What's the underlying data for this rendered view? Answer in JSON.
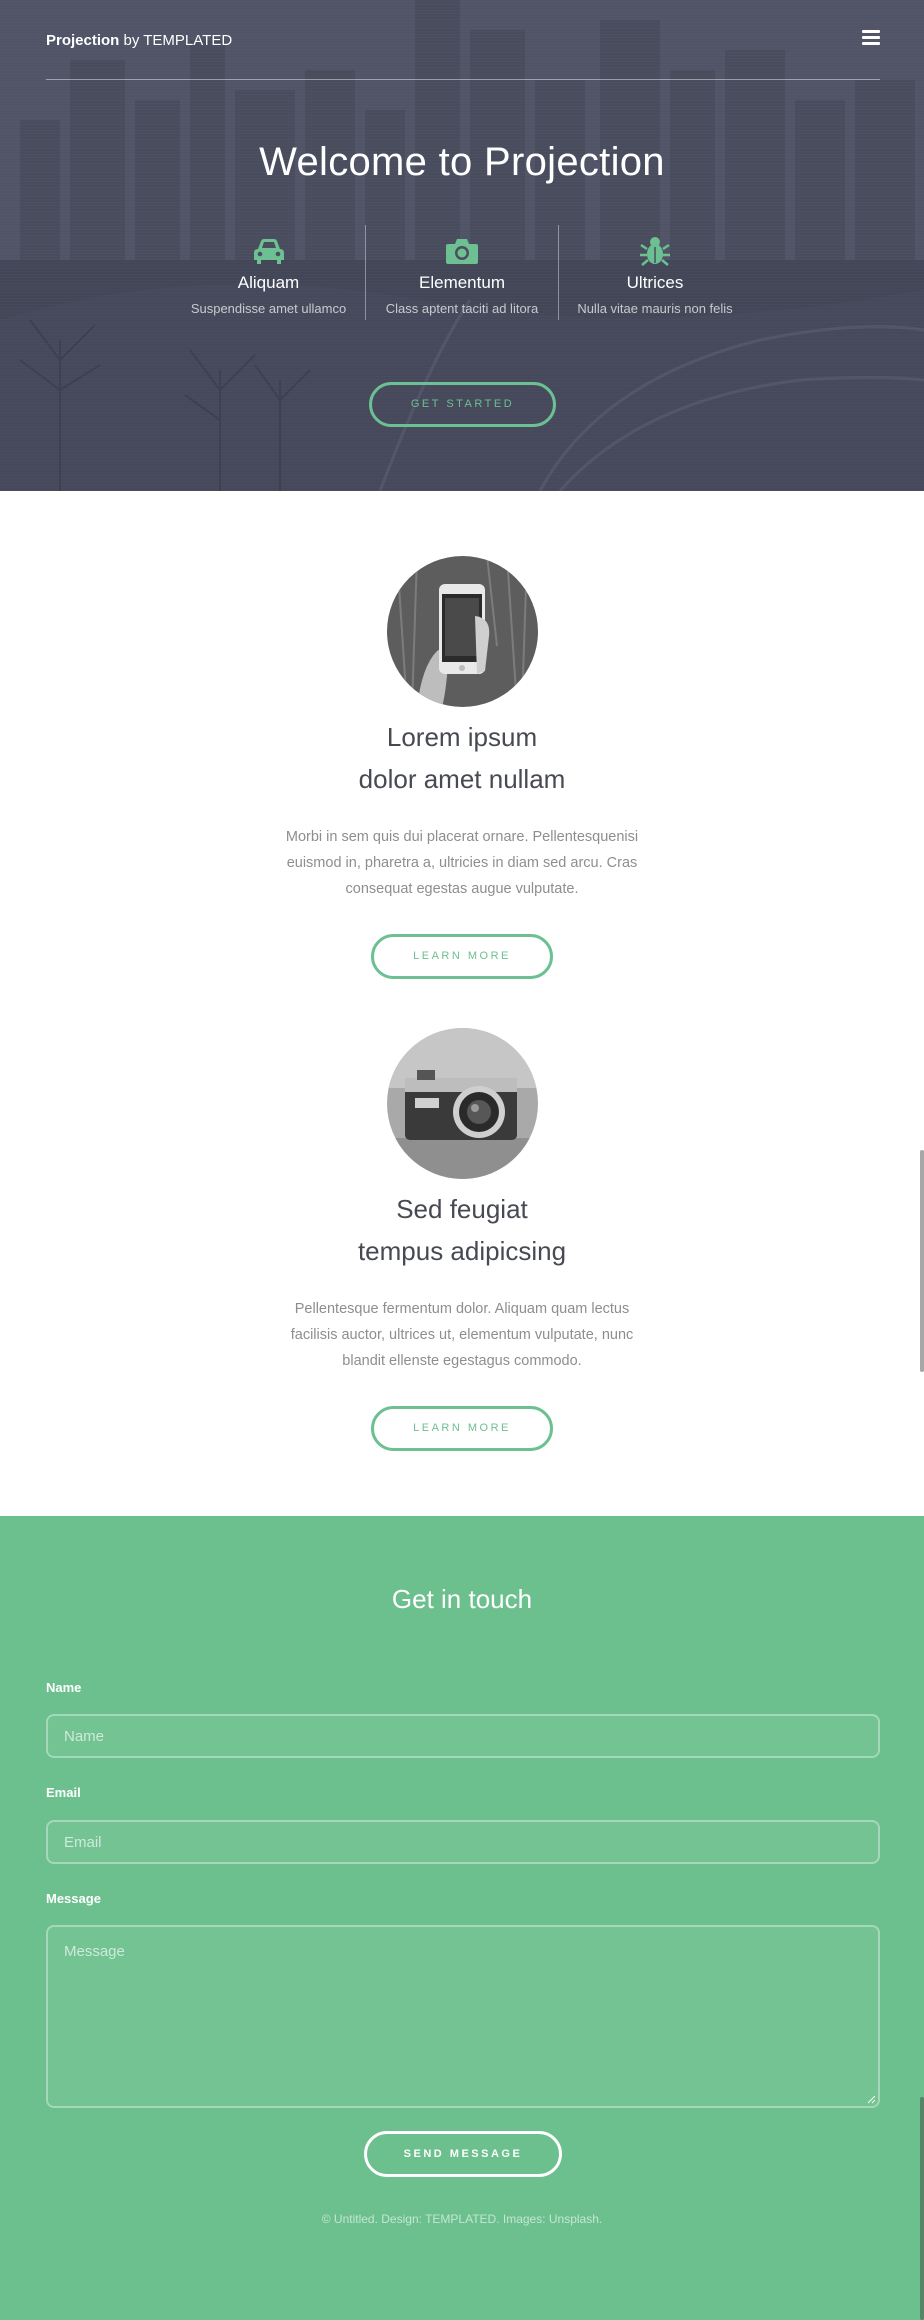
{
  "header": {
    "logo_bold": "Projection",
    "logo_rest": " by TEMPLATED",
    "menu_icon": "hamburger-menu-icon"
  },
  "hero": {
    "title": "Welcome to Projection",
    "features": [
      {
        "icon": "car-icon",
        "title": "Aliquam",
        "subtitle": "Suspendisse amet ullamco"
      },
      {
        "icon": "camera-icon",
        "title": "Elementum",
        "subtitle": "Class aptent taciti ad litora"
      },
      {
        "icon": "bug-icon",
        "title": "Ultrices",
        "subtitle": "Nulla vitae mauris non felis"
      }
    ],
    "cta_label": "GET STARTED"
  },
  "spotlights": [
    {
      "image": "phone-photo",
      "title_line1": "Lorem ipsum",
      "title_line2": "dolor amet nullam",
      "description": "Morbi in sem quis dui placerat ornare. Pellentesquenisi euismod in, pharetra a, ultricies in diam sed arcu. Cras consequat egestas augue vulputate.",
      "button_label": "LEARN MORE"
    },
    {
      "image": "camera-photo",
      "title_line1": "Sed feugiat",
      "title_line2": "tempus adipicsing",
      "description": "Pellentesque fermentum dolor. Aliquam quam lectus facilisis auctor, ultrices ut, elementum vulputate, nunc blandit ellenste egestagus commodo.",
      "button_label": "LEARN MORE"
    }
  ],
  "contact": {
    "title": "Get in touch",
    "name_label": "Name",
    "name_placeholder": "Name",
    "email_label": "Email",
    "email_placeholder": "Email",
    "message_label": "Message",
    "message_placeholder": "Message",
    "send_label": "SEND MESSAGE",
    "copyright": "© Untitled. Design: TEMPLATED. Images: Unsplash."
  },
  "colors": {
    "accent": "#6cc091",
    "contact_bg": "#6cc08e",
    "hero_bg": "#4d5062",
    "heading_text": "#474a52",
    "body_text": "#8e8e8e"
  }
}
